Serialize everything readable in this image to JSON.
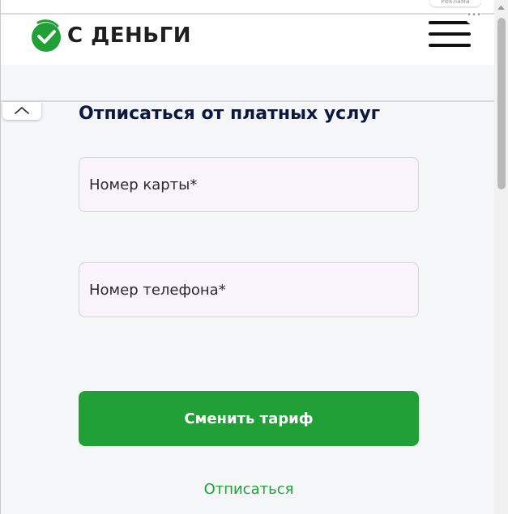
{
  "header": {
    "brand_name": "С ДЕНЬГИ",
    "ad_badge_label": "Реклама",
    "ad_menu_label": "•••"
  },
  "form": {
    "title": "Отписаться от платных услуг",
    "card_placeholder": "Номер карты*",
    "phone_placeholder": "Номер телефона*",
    "submit_label": "Сменить тариф",
    "unsubscribe_label": "Отписаться"
  },
  "colors": {
    "brand_green": "#21a038",
    "title_navy": "#0e1640",
    "field_background": "#f9f3fb"
  },
  "icons": {
    "logo": "checkmark-circle-logo",
    "menu": "hamburger-menu-icon",
    "collapse": "chevron-up-icon"
  }
}
